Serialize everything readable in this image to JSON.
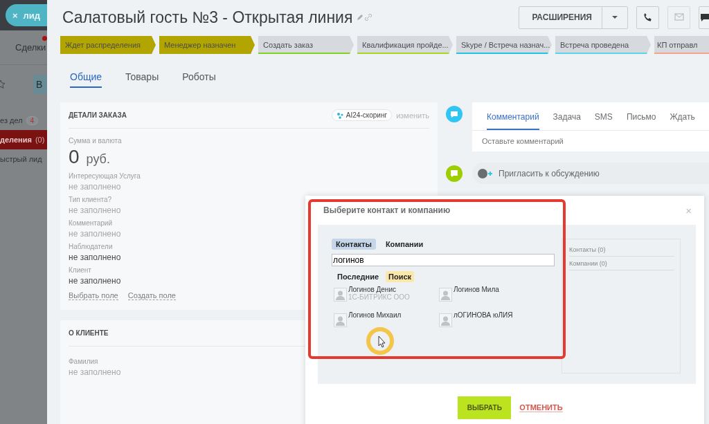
{
  "background_page": {
    "chip": {
      "close": "×",
      "label": "лид"
    },
    "nav_label": "Сделки",
    "nav_alert": true,
    "button_text": "В",
    "filters": [
      {
        "label": "ез дел",
        "count": "4",
        "kind": "badge",
        "selected": false
      },
      {
        "label": "деления",
        "count": "(0)",
        "kind": "counter",
        "selected": true
      },
      {
        "label": "ыстрый лид",
        "kind": "plain",
        "selected": false
      }
    ]
  },
  "title": "Салатовый гость №3 - Открытая линия",
  "header_buttons": {
    "extensions": "РАСШИРЕНИЯ"
  },
  "stages": [
    {
      "label": "Ждет распределения",
      "done": true,
      "color": "#b3a500"
    },
    {
      "label": "Менеджер назначен",
      "done": true,
      "color": "#b3a500"
    },
    {
      "label": "Создать заказ",
      "done": false,
      "color": "#7ed321"
    },
    {
      "label": "Квалификация пройде...",
      "done": false,
      "color": "#a6d61e"
    },
    {
      "label": "Skype / Встреча назнач...",
      "done": false,
      "color": "#22c3e6"
    },
    {
      "label": "Встреча проведена",
      "done": false,
      "color": "#5dd3ea"
    },
    {
      "label": "КП отправл",
      "done": false,
      "color": "#f5a38e"
    }
  ],
  "tabs": [
    {
      "label": "Общие",
      "selected": true
    },
    {
      "label": "Товары",
      "selected": false
    },
    {
      "label": "Роботы",
      "selected": false
    }
  ],
  "order_card": {
    "title": "ДЕТАЛИ ЗАКАЗА",
    "scoring": "AI24-скоринг",
    "edit": "изменить",
    "amount": {
      "label": "Сумма и валюта",
      "value": "0",
      "currency": "руб."
    },
    "fields": [
      {
        "label": "Интересующая Услуга",
        "value": "не заполнено",
        "muted": true
      },
      {
        "label": "Тип клиента?",
        "value": "не заполнено",
        "muted": true
      },
      {
        "label": "Комментарий",
        "value": "не заполнено",
        "muted": true
      },
      {
        "label": "Наблюдатели",
        "value": "не заполнено",
        "muted": false
      },
      {
        "label": "Клиент",
        "value": "не заполнено",
        "muted": false
      }
    ],
    "links": [
      "Выбрать поле",
      "Создать поле"
    ]
  },
  "client_card": {
    "title": "О КЛИЕНТЕ",
    "fields": [
      {
        "label": "Фамилия",
        "value": "не заполнено",
        "muted": true
      }
    ]
  },
  "timeline": {
    "composer_tabs": [
      {
        "label": "Комментарий",
        "selected": true
      },
      {
        "label": "Задача",
        "selected": false
      },
      {
        "label": "SMS",
        "selected": false
      },
      {
        "label": "Письмо",
        "selected": false
      },
      {
        "label": "Ждать",
        "selected": false
      }
    ],
    "placeholder": "Оставьте комментарий",
    "invite": "Пригласить к обсуждению"
  },
  "dialog": {
    "title": "Выберите контакт и компанию",
    "close": "×",
    "entity_tabs": [
      {
        "label": "Контакты",
        "selected": true
      },
      {
        "label": "Компании",
        "selected": false
      }
    ],
    "search": {
      "value": "логинов"
    },
    "mode_tabs": [
      {
        "label": "Последние",
        "selected": false
      },
      {
        "label": "Поиск",
        "selected": true
      }
    ],
    "results": [
      {
        "name": "Логинов Денис",
        "company": "1С-БИТРИКС ООО"
      },
      {
        "name": "Логинов Мила"
      },
      {
        "name": "Логинов Михаил"
      },
      {
        "name": "лОГИНОВА юЛИЯ"
      }
    ],
    "selected_groups": [
      "Контакты (0)",
      "Компании (0)"
    ],
    "buttons": {
      "confirm": "ВЫБРАТЬ",
      "cancel": "ОТМЕНИТЬ"
    }
  }
}
